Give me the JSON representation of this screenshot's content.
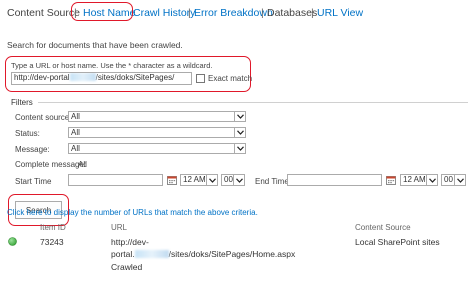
{
  "nav": {
    "tabs": [
      {
        "label": "Content Source"
      },
      {
        "label": "Host Name"
      },
      {
        "label": "Crawl History"
      },
      {
        "label": "Error Breakdown"
      },
      {
        "label": "Databases"
      },
      {
        "label": "URL View"
      }
    ],
    "separator": "|"
  },
  "intro": "Search for documents that have been crawled.",
  "url_search": {
    "hint": "Type a URL or host name. Use the * character as a wildcard.",
    "value_prefix": "http://dev-portal",
    "value_suffix": "/sites/doks/SitePages/",
    "exact_match_label": "Exact match",
    "exact_match_checked": false
  },
  "filters": {
    "title": "Filters",
    "content_source": {
      "label": "Content source:",
      "value": "All"
    },
    "status": {
      "label": "Status:",
      "value": "All"
    },
    "message": {
      "label": "Message:",
      "value": "All"
    },
    "complete_message": {
      "label": "Complete message:",
      "value": "All"
    },
    "start_time": {
      "label": "Start Time",
      "hour": "12 AM",
      "minute": "00"
    },
    "end_time": {
      "label": "End Time",
      "hour": "12 AM",
      "minute": "00"
    }
  },
  "search_button": "Search",
  "count_link": "Click here to display the number of URLs that match the above criteria.",
  "results": {
    "columns": {
      "item_id": "Item ID",
      "url": "URL",
      "content_source": "Content Source"
    },
    "rows": [
      {
        "status_color": "#3aa63a",
        "item_id": "73243",
        "url_line1": "http://dev-",
        "url_line2_prefix": "portal.",
        "url_line2_suffix": "/sites/doks/SitePages/Home.aspx",
        "content_source": "Local SharePoint sites",
        "status_text": "Crawled"
      }
    ]
  },
  "colors": {
    "link": "#0072c6",
    "highlight": "#e0182a",
    "status_ok": "#3aa63a"
  }
}
